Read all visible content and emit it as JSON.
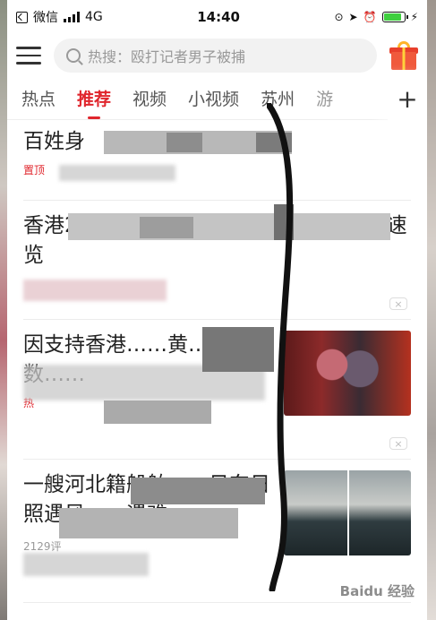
{
  "status_bar": {
    "app": "微信",
    "network": "4G",
    "time": "14:40"
  },
  "header": {
    "search_placeholder": "热搜：殴打记者男子被捕"
  },
  "tabs": [
    {
      "label": "热点"
    },
    {
      "label": "推荐",
      "active": true
    },
    {
      "label": "视频"
    },
    {
      "label": "小视频"
    },
    {
      "label": "苏州"
    },
    {
      "label": "游"
    }
  ],
  "tab_add": "+",
  "feed": [
    {
      "title": "百姓身",
      "tag": "置顶",
      "meta": ""
    },
    {
      "title": "香港2……………………生了什么？一文速览",
      "meta": ""
    },
    {
      "title": "因支持香港……黄……数……",
      "tag": "热",
      "meta": ""
    },
    {
      "title": "一艘河北籍船舶……日东日照遇风……遇难……",
      "meta": "2129评"
    }
  ],
  "close_label": "×",
  "watermark": "Baidu 经验",
  "accent_color": "#e0262d"
}
